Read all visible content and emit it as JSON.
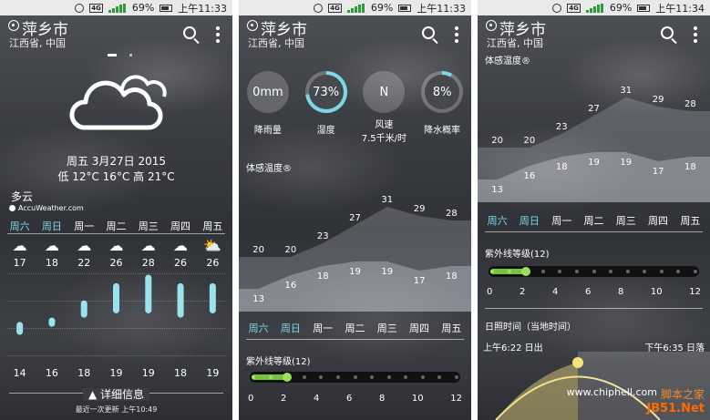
{
  "status": {
    "battery": "69%",
    "time": "上午11:33",
    "time_p3": "上午11:34",
    "network": "4G"
  },
  "location": {
    "city": "萍乡市",
    "province": "江西省, 中国"
  },
  "icons": {
    "search": "search-icon",
    "more": "more-vert-icon",
    "pin": "location-pin-icon",
    "weather_main": "cloudy-icon"
  },
  "current": {
    "date": "周五 3月27日 2015",
    "temp_line": "低 12°C 16°C 高 21°C",
    "condition": "多云",
    "provider": "AccuWeather.com"
  },
  "days": [
    "周六",
    "周日",
    "周一",
    "周二",
    "周三",
    "周四",
    "周五"
  ],
  "highlight_color": "#7dd8e6",
  "forecast": {
    "highs": [
      "17",
      "18",
      "22",
      "26",
      "28",
      "26",
      "26"
    ],
    "lows": [
      "14",
      "16",
      "18",
      "19",
      "19",
      "18",
      "19"
    ],
    "conditions": [
      "rain",
      "rain",
      "cloudy",
      "rain",
      "cloudy",
      "cloudy",
      "partly-sunny"
    ]
  },
  "footer": {
    "more_info": "▲ 详细信息",
    "last_updated": "最近一次更新 上午10:49"
  },
  "details": {
    "rain": {
      "value": "0mm",
      "label": "降雨量"
    },
    "humidity": {
      "value": "73%",
      "label": "湿度",
      "percent": 73
    },
    "wind": {
      "value": "N",
      "label": "风速",
      "speed": "7.5千米/时"
    },
    "precip": {
      "value": "8%",
      "label": "降水概率",
      "percent": 8
    }
  },
  "feels_like": {
    "title": "体感温度®",
    "highs": [
      "20",
      "20",
      "23",
      "27",
      "31",
      "29",
      "28"
    ],
    "lows": [
      "13",
      "16",
      "18",
      "19",
      "19",
      "17",
      "18"
    ]
  },
  "uv": {
    "title": "紫外线等级(12)",
    "ticks": [
      "0",
      "2",
      "4",
      "6",
      "8",
      "10",
      "12"
    ],
    "level": 2
  },
  "sun": {
    "title": "日照时间（当地时间）",
    "sunrise": "上午6:22 日出",
    "sunset": "下午6:35 日落"
  },
  "watermark": {
    "site": "www.chiphell.com",
    "jb": "JB51.Net",
    "logo": "脚本之家"
  }
}
